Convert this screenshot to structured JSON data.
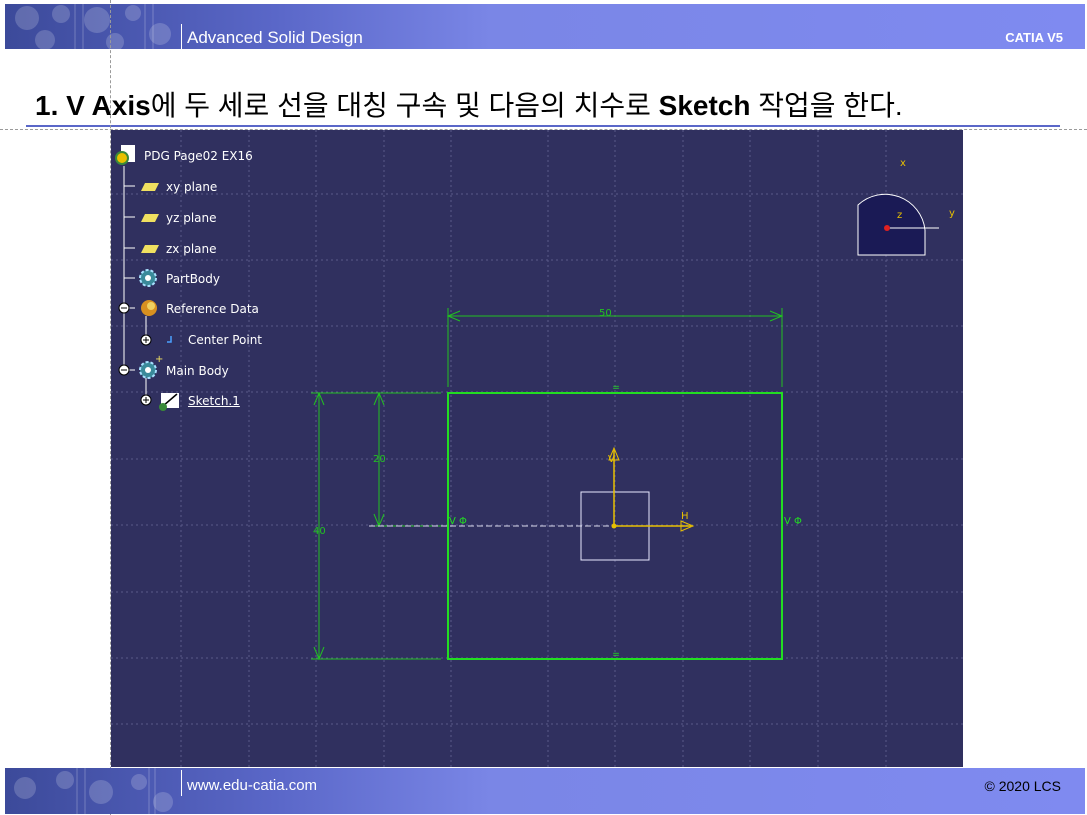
{
  "header": {
    "left_title": "Advanced Solid Design",
    "right_title": "CATIA V5"
  },
  "slide": {
    "title_parts": [
      "1. V Axis",
      "에 두 세로 선을 대칭 구속 및 다음의 치수로 ",
      "Sketch",
      " 작업을 한다."
    ]
  },
  "tree": [
    {
      "label": "PDG Page02 EX16",
      "icon": "part-document-icon"
    },
    {
      "label": "xy plane",
      "icon": "plane-icon"
    },
    {
      "label": "yz plane",
      "icon": "plane-icon"
    },
    {
      "label": "zx plane",
      "icon": "plane-icon"
    },
    {
      "label": "PartBody",
      "icon": "partbody-gear-icon"
    },
    {
      "label": "Reference Data",
      "icon": "reference-data-icon"
    },
    {
      "label": "Center Point",
      "icon": "point-icon"
    },
    {
      "label": "Main Body",
      "icon": "body-gear-icon"
    },
    {
      "label": "Sketch.1",
      "icon": "sketch-icon"
    }
  ],
  "compass": {
    "x": "x",
    "y": "y",
    "z": "z"
  },
  "sketch": {
    "dim_width": "50",
    "dim_upper": "20",
    "dim_height": "40",
    "axis_v": "V",
    "axis_h": "H",
    "sym_left": "V Φ",
    "sym_right": "V Φ"
  },
  "footer": {
    "website": "www.edu-catia.com",
    "copyright": "© 2020 LCS"
  },
  "colors": {
    "viewport_bg": "#30305f",
    "sketch_green": "#22dd22",
    "dim_green": "#22c022",
    "axis_yellow": "#e8c000",
    "band_blue": "#7f8af0"
  }
}
